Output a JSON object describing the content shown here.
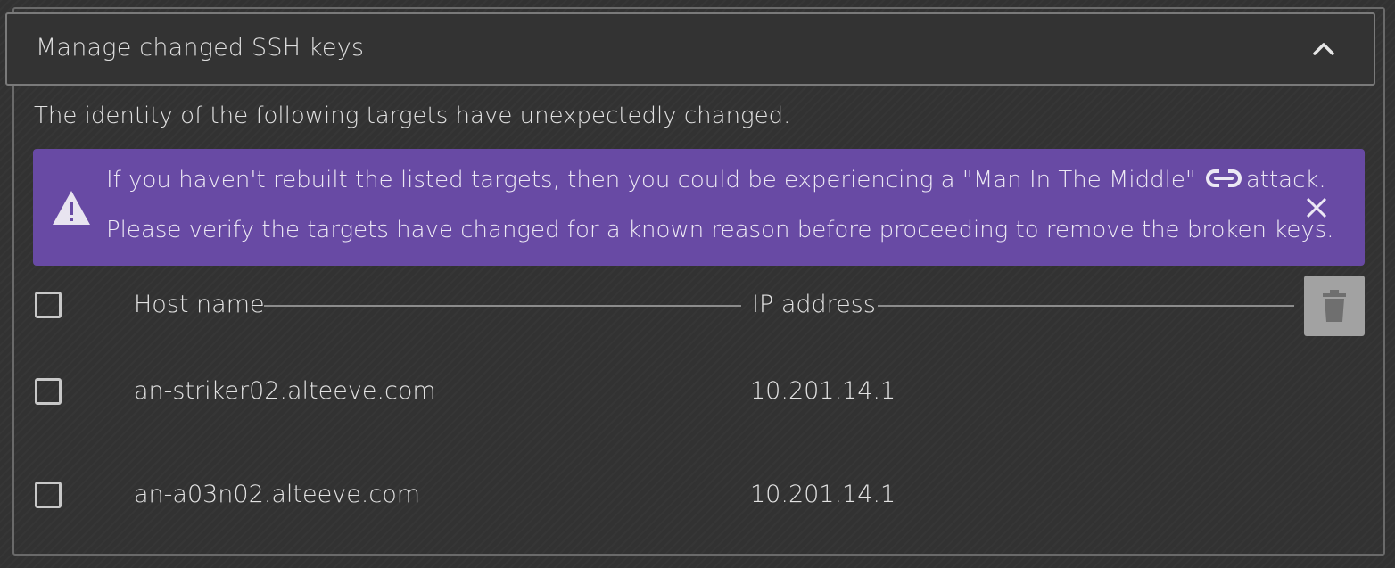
{
  "panel": {
    "title": "Manage changed SSH keys",
    "collapse_icon": "chevron-up-icon"
  },
  "description": "The identity of the following targets have unexpectedly changed.",
  "alert": {
    "icon": "warning-icon",
    "line1_before_link": "If you haven't rebuilt the listed targets, then you could be experiencing a \"Man In The Middle\"",
    "link_icon": "link-icon",
    "line1_after_link": "attack.",
    "line2": "Please verify the targets have changed for a known reason before proceeding to remove the broken keys.",
    "close_icon": "close-icon",
    "background_color": "#684aa4"
  },
  "table": {
    "columns": [
      "Host name",
      "IP address"
    ],
    "delete_icon": "trash-icon",
    "rows": [
      {
        "host": "an-striker02.alteeve.com",
        "ip": "10.201.14.1",
        "checked": false
      },
      {
        "host": "an-a03n02.alteeve.com",
        "ip": "10.201.14.1",
        "checked": false
      }
    ]
  }
}
